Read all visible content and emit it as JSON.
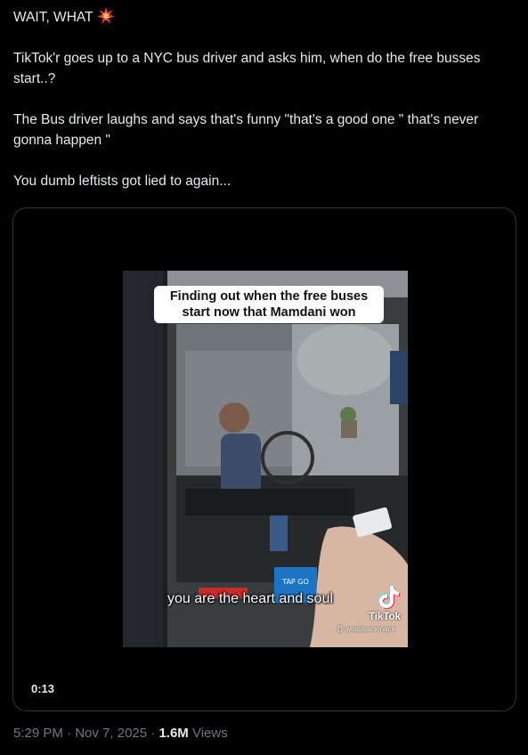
{
  "tweet": {
    "line1": "WAIT, WHAT",
    "line1_emoji": "collision-icon",
    "para2": "TikTok'r goes up to a NYC bus driver and asks him, when do the free busses start..?",
    "para3": "The Bus driver laughs and says that's funny \"that's a good one \" that's never gonna happen \"",
    "para4": "You dumb leftists got lied to again..."
  },
  "video": {
    "caption": "Finding out when the free buses start now that Mamdani won",
    "subtitle": "you are the heart and soul",
    "brand": "TikTok",
    "handle": "@ whatisamenace",
    "duration": "0:13",
    "tap_sign": "TAP GO"
  },
  "meta": {
    "time": "5:29 PM",
    "separator1": " · ",
    "date": "Nov 7, 2025",
    "separator2": " · ",
    "views_count": "1.6M",
    "views_label": " Views"
  },
  "colors": {
    "background": "#000000",
    "text": "#e7e9ea",
    "muted": "#71767b",
    "border": "#2f3336"
  }
}
